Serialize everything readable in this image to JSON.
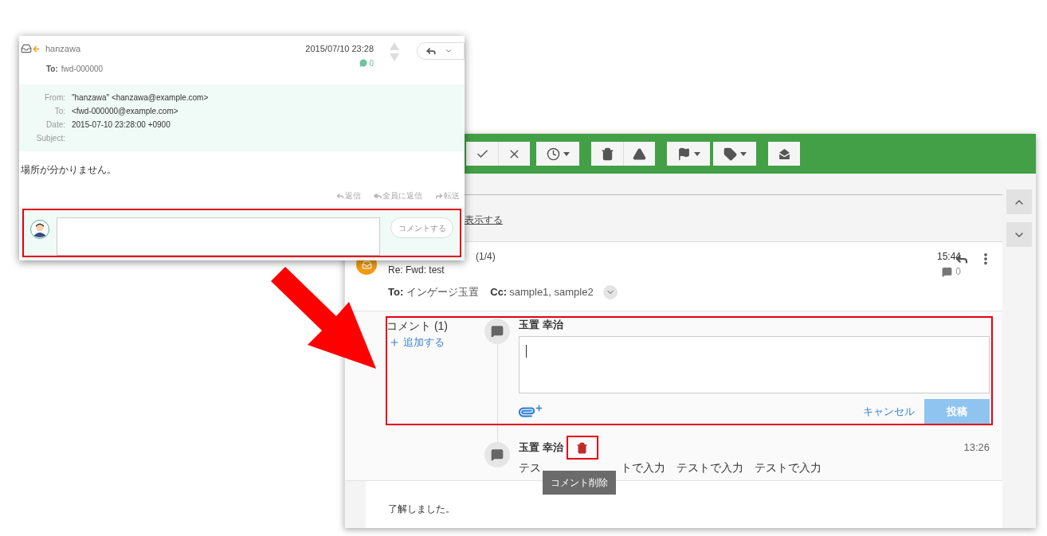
{
  "old_window": {
    "sender": "hanzawa",
    "date": "2015/07/10 23:28",
    "comment_count": "0",
    "to_label": "To:",
    "to_value": "fwd-000000",
    "headers": [
      {
        "label": "From:",
        "value": "\"hanzawa\" <hanzawa@example.com>"
      },
      {
        "label": "To:",
        "value": "<fwd-000000@example.com>"
      },
      {
        "label": "Date:",
        "value": "2015-07-10 23:28:00 +0900"
      },
      {
        "label": "Subject:"
      }
    ],
    "body": "場所が分かりません。",
    "actions": [
      {
        "kind": "reply",
        "label": "返信"
      },
      {
        "kind": "reply_all",
        "label": "全員に返信"
      },
      {
        "kind": "forward",
        "label": "転送"
      }
    ],
    "comment_button": "コメントする"
  },
  "new_window": {
    "toolbar": [
      [
        {
          "kind": "check",
          "dropdown": false
        },
        {
          "kind": "close",
          "dropdown": false
        }
      ],
      [
        {
          "kind": "clock",
          "dropdown": true
        }
      ],
      [
        {
          "kind": "trash",
          "dropdown": false
        },
        {
          "kind": "warning",
          "dropdown": false
        }
      ],
      [
        {
          "kind": "flag",
          "dropdown": true
        }
      ],
      [
        {
          "kind": "tag",
          "dropdown": true
        }
      ],
      [
        {
          "kind": "mail",
          "dropdown": false
        }
      ]
    ],
    "show_link": "表示する",
    "message": {
      "subject_rest": "(1/4)",
      "subtitle": "Re: Fwd: test",
      "time": "15:44",
      "comment_count": "0",
      "to_label": "To:",
      "to_value": "インゲージ玉置",
      "cc_label": "Cc:",
      "cc_value": "sample1, sample2"
    },
    "comments": {
      "heading": "コメント (1)",
      "add": "追加する",
      "editor": {
        "author": "玉置 幸治",
        "cancel": "キャンセル",
        "post": "投稿",
        "post_disabled": true
      },
      "items": [
        {
          "author": "玉置 幸治",
          "time": "13:26",
          "text_start": "テス",
          "text_rest": "トで入力　テストで入力　テストで入力",
          "tooltip": "コメント削除"
        }
      ]
    },
    "body": "了解しました。"
  }
}
